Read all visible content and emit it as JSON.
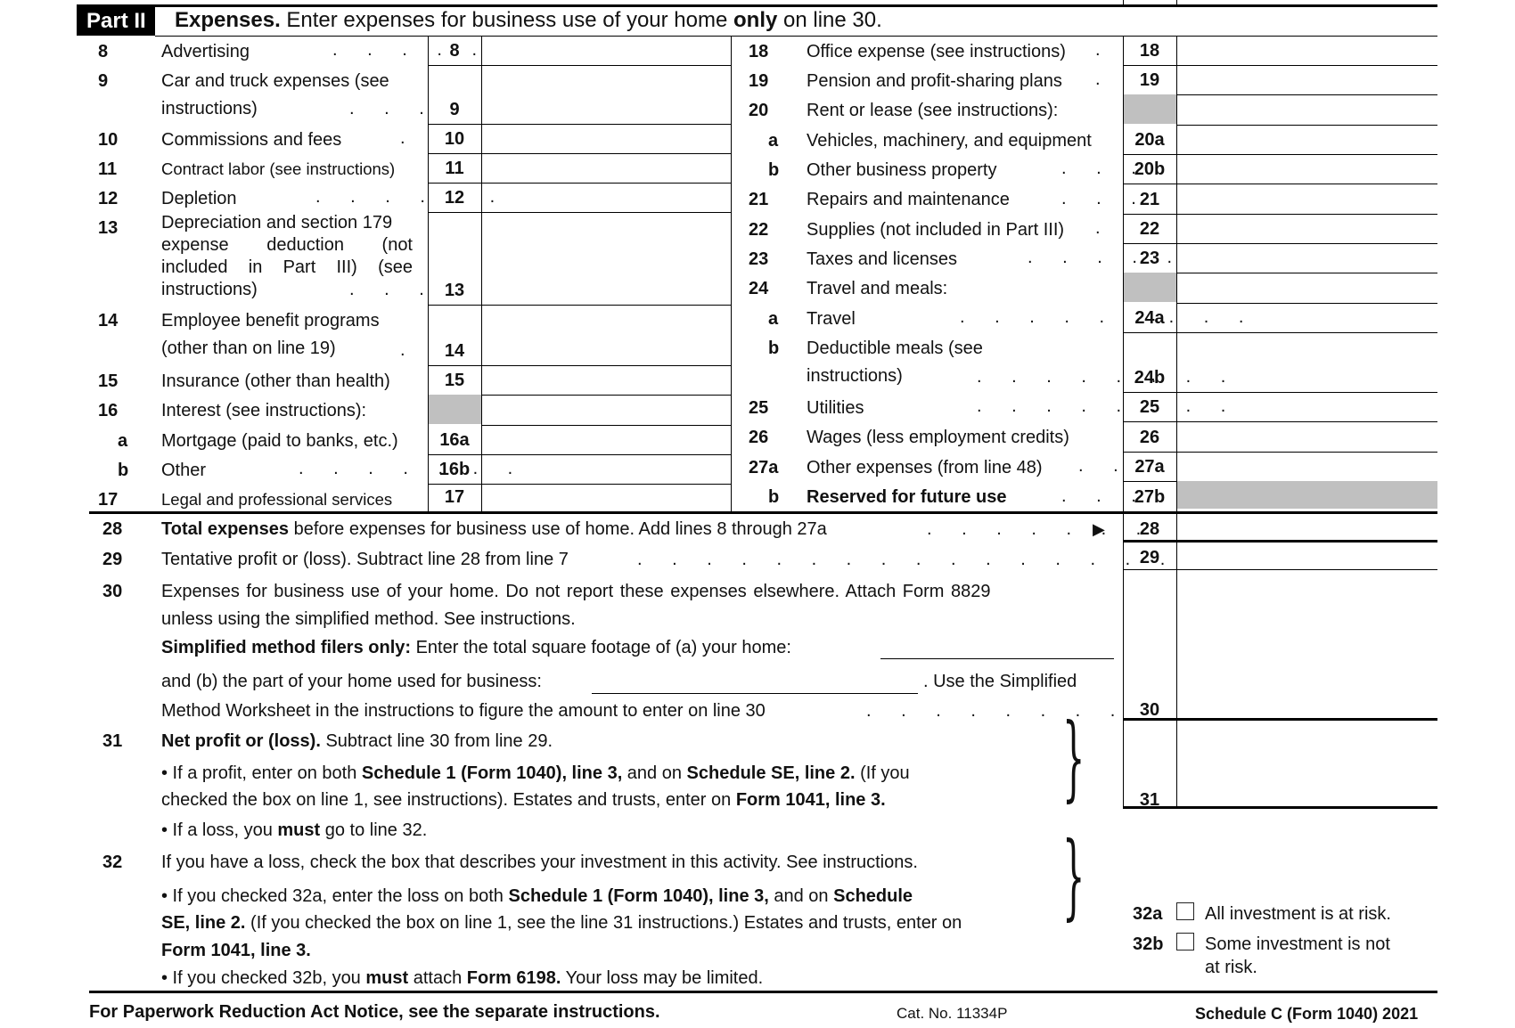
{
  "part": {
    "badge": "Part II",
    "title_bold": "Expenses.",
    "title_rest_1": " Enter expenses for business use of your home ",
    "title_bold_2": "only",
    "title_rest_2": " on line 30."
  },
  "left_lines": [
    {
      "num": "8",
      "label": "Advertising",
      "dots": ". . . . .",
      "box": "8",
      "value": ""
    },
    {
      "num": "9",
      "label": "Car and truck expenses (see",
      "label2": "instructions)",
      "dots": ". . . .",
      "box": "9",
      "value": ""
    },
    {
      "num": "10",
      "label": "Commissions and fees",
      "dots": ".",
      "box": "10",
      "value": ""
    },
    {
      "num": "11",
      "label": "Contract labor (see instructions)",
      "box": "11",
      "value": ""
    },
    {
      "num": "12",
      "label": "Depletion",
      "dots": ". . . . . .",
      "box": "12",
      "value": ""
    },
    {
      "num": "13",
      "label": "Depreciation and section 179",
      "label2": "expense deduction (not",
      "label3": "included in Part III) (see",
      "label4": "instructions)",
      "dots": ". . . .",
      "box": "13",
      "value": ""
    },
    {
      "num": "14",
      "label": "Employee benefit programs",
      "label2": "(other than on line 19)",
      "dots": ".",
      "box": "14",
      "value": ""
    },
    {
      "num": "15",
      "label": "Insurance (other than health)",
      "box": "15",
      "value": ""
    },
    {
      "num": "16",
      "label": "Interest (see instructions):"
    },
    {
      "num": "a",
      "label": "Mortgage (paid to banks, etc.)",
      "box": "16a",
      "value": ""
    },
    {
      "num": "b",
      "label": "Other",
      "dots": ". . . . . . .",
      "box": "16b",
      "value": ""
    },
    {
      "num": "17",
      "label": "Legal and professional services",
      "box": "17",
      "value": ""
    }
  ],
  "right_lines": [
    {
      "num": "18",
      "label": "Office expense (see instructions)",
      "dots": ".",
      "box": "18",
      "value": ""
    },
    {
      "num": "19",
      "label": "Pension and profit-sharing plans",
      "dots": ".",
      "box": "19",
      "value": ""
    },
    {
      "num": "20",
      "label": "Rent or lease (see instructions):"
    },
    {
      "num": "a",
      "label": "Vehicles, machinery, and equipment",
      "box": "20a",
      "value": ""
    },
    {
      "num": "b",
      "label": "Other business property",
      "dots": ". . .",
      "box": "20b",
      "value": ""
    },
    {
      "num": "21",
      "label": "Repairs and maintenance",
      "dots": ". . .",
      "box": "21",
      "value": ""
    },
    {
      "num": "22",
      "label": "Supplies (not included in Part III)",
      "dots": ".",
      "box": "22",
      "value": ""
    },
    {
      "num": "23",
      "label": "Taxes and licenses",
      "dots": ". . . . .",
      "box": "23",
      "value": ""
    },
    {
      "num": "24",
      "label": "Travel and meals:"
    },
    {
      "num": "a",
      "label": "Travel",
      "dots": ". . . . . . . . .",
      "box": "24a",
      "value": ""
    },
    {
      "num": "b",
      "label": "Deductible meals (see",
      "label2": "instructions)",
      "dots": ". . . . . . . .",
      "box": "24b",
      "value": ""
    },
    {
      "num": "25",
      "label": "Utilities",
      "dots": ". . . . . . . .",
      "box": "25",
      "value": ""
    },
    {
      "num": "26",
      "label": "Wages (less employment credits)",
      "box": "26",
      "value": ""
    },
    {
      "num": "27a",
      "label": "Other expenses (from line 48)",
      "dots": ". .",
      "box": "27a",
      "value": ""
    },
    {
      "num": "b",
      "label": "Reserved for future use",
      "dots": ". . .",
      "box": "27b"
    }
  ],
  "line28": {
    "num": "28",
    "bold": "Total expenses",
    "rest": " before expenses for business use of home. Add lines 8 through 27a",
    "dots": ". . . . . . .",
    "arrow": "▶",
    "box": "28",
    "value": ""
  },
  "line29": {
    "num": "29",
    "text": "Tentative profit or (loss). Subtract line 28 from line 7",
    "dots": ". . . . . . . . . . . . . . . .",
    "box": "29",
    "value": ""
  },
  "line30": {
    "num": "30",
    "text1": "Expenses for business use of your home. Do not report these expenses elsewhere. Attach Form 8829",
    "text2": "unless using the simplified method. See instructions.",
    "bold3": "Simplified method filers only:",
    "text3": " Enter the total square footage of (a) your home:",
    "text4a": "and (b) the part of your home used for business:",
    "text4b": ". Use the Simplified",
    "text5": "Method Worksheet in the instructions to figure the amount to enter on line 30",
    "dots5": ". . . . . . . .",
    "home_sqft": "",
    "business_sqft": "",
    "box": "30",
    "value": ""
  },
  "line31": {
    "num": "31",
    "bold1": "Net profit or (loss).",
    "text1": " Subtract line 30 from line 29.",
    "b1_pre": "• If a profit, enter on both ",
    "b1_bold1": "Schedule 1 (Form 1040), line 3,",
    "b1_mid": " and on ",
    "b1_bold2": "Schedule SE, line 2.",
    "b1_post": " (If you",
    "b1_line2_pre": "checked the box on line 1, see instructions). Estates and trusts, enter on ",
    "b1_line2_bold": "Form 1041, line 3.",
    "b2_pre": "• If a loss, you ",
    "b2_bold": "must",
    "b2_post": "  go to line 32.",
    "box": "31",
    "value": ""
  },
  "line32": {
    "num": "32",
    "text": "If you have a loss, check the box that describes your investment in this activity. See instructions.",
    "b1_pre": "• If you checked 32a, enter the loss on both ",
    "b1_bold1": "Schedule 1 (Form 1040), line 3,",
    "b1_mid": " and on ",
    "b1_bold2": "Schedule",
    "b1_l2_bold": "SE, line 2.",
    "b1_l2_rest": " (If you checked the box on line 1, see the line 31 instructions.) Estates and trusts, enter on",
    "b1_l3_bold": "Form 1041, line 3.",
    "b2_pre": "• If you checked 32b, you ",
    "b2_bold1": "must",
    "b2_mid": " attach ",
    "b2_bold2": "Form 6198.",
    "b2_post": " Your loss may be limited.",
    "opt_a_num": "32a",
    "opt_a_label": "All investment is at risk.",
    "opt_a_checked": false,
    "opt_b_num": "32b",
    "opt_b_label": "Some investment is not",
    "opt_b_label2": "at risk.",
    "opt_b_checked": false
  },
  "footer": {
    "paperwork": "For Paperwork Reduction Act Notice, see the separate instructions.",
    "cat": "Cat. No. 11334P",
    "form": "Schedule C (Form 1040) 2021"
  },
  "icons": {
    "brace": "}"
  }
}
